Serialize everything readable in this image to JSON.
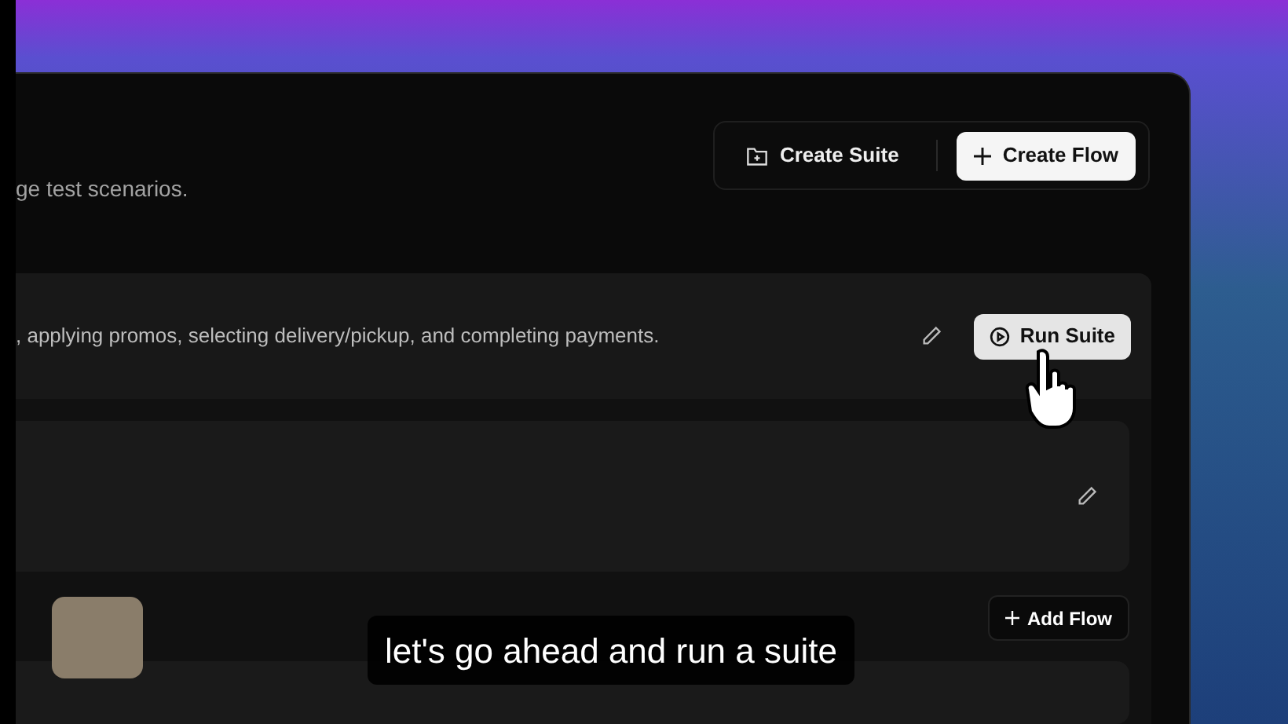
{
  "header": {
    "description": "ge test scenarios.",
    "actions": [
      {
        "label": "Create Suite",
        "kind": "ghost"
      },
      {
        "label": "Create Flow",
        "kind": "primary"
      }
    ]
  },
  "suite": {
    "description": ", applying promos, selecting delivery/pickup, and completing payments.",
    "run_button": "Run Suite"
  },
  "flows_section": {
    "add_button": "Add Flow"
  },
  "caption": "let's go ahead and run a suite"
}
